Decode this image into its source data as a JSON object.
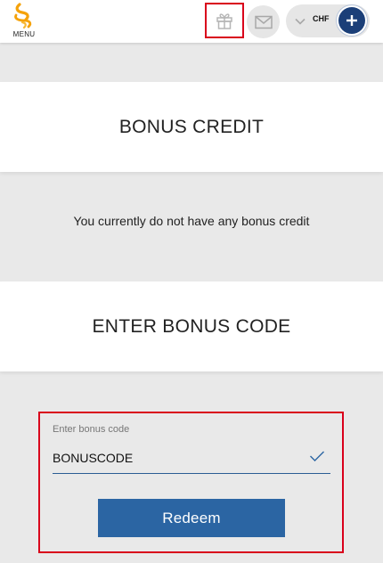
{
  "header": {
    "menu_label": "MENU",
    "currency": "CHF",
    "brand_color": "#f5a20a",
    "accent_color": "#1b3f78",
    "icons": [
      "menu-logo-icon",
      "gift-icon",
      "mail-icon",
      "chevron-down-icon",
      "plus-icon"
    ]
  },
  "bonus_credit": {
    "title": "BONUS CREDIT",
    "message": "You currently do not have any bonus credit"
  },
  "bonus_code": {
    "title": "ENTER BONUS CODE",
    "field_label": "Enter bonus code",
    "field_value": "BONUSCODE",
    "redeem_label": "Redeem",
    "button_color": "#2b65a3"
  }
}
